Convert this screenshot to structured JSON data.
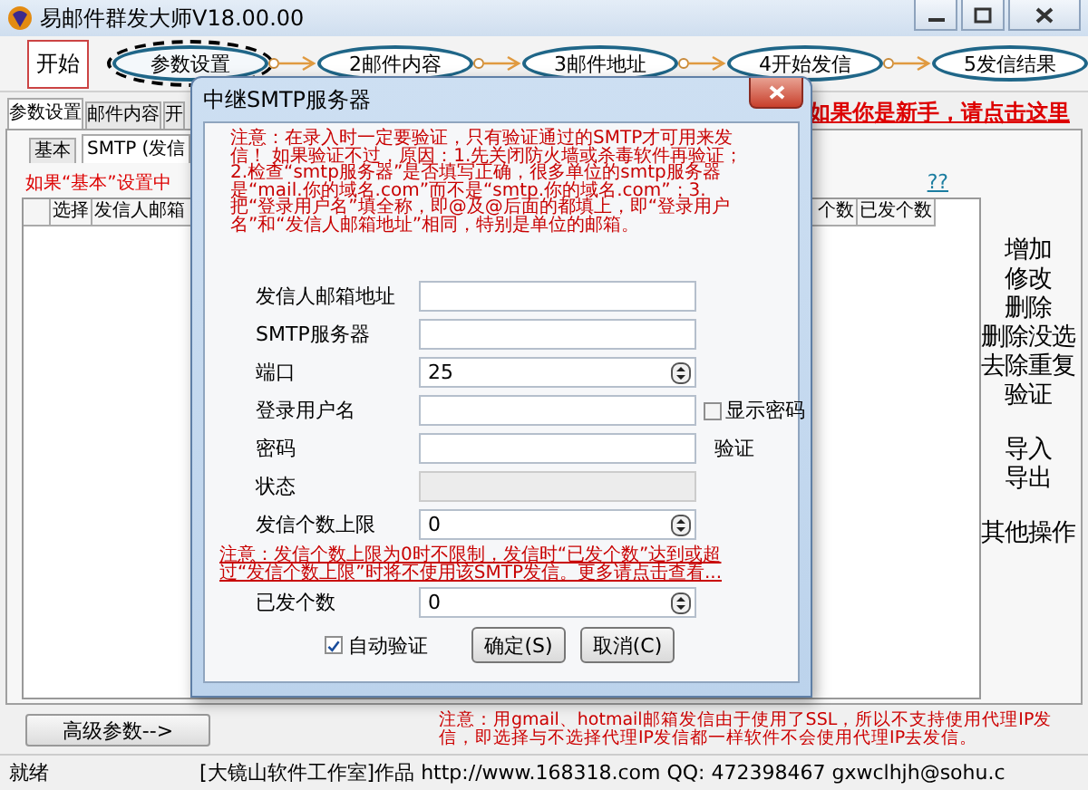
{
  "window": {
    "title": "易邮件群发大师V18.00.00"
  },
  "steps": {
    "start": "开始",
    "items": [
      {
        "label": "参数设置",
        "selected": true
      },
      {
        "label": "2邮件内容",
        "selected": false
      },
      {
        "label": "3邮件地址",
        "selected": false
      },
      {
        "label": "4开始发信",
        "selected": false
      },
      {
        "label": "5发信结果",
        "selected": false
      }
    ]
  },
  "tabs": [
    {
      "label": "参数设置",
      "selected": true
    },
    {
      "label": "邮件内容",
      "selected": false
    },
    {
      "label": "开",
      "selected": false
    }
  ],
  "newbie_link": "如果你是新手，请点击这里",
  "sub_tabs": [
    {
      "label": "基本",
      "selected": false
    },
    {
      "label": "SMTP (发信",
      "selected": true
    }
  ],
  "hint": "如果“基本”设置中",
  "help_link": "??",
  "table": {
    "columns": [
      "选择",
      "发信人邮箱",
      "个数",
      "已发个数"
    ]
  },
  "side_buttons": [
    [
      "增加",
      "修改",
      "删除",
      "删除没选",
      "去除重复",
      "验证"
    ],
    [
      "导入",
      "导出"
    ],
    [
      "其他操作"
    ]
  ],
  "advanced_button": "高级参数-->",
  "ssl_note": "注意：用gmail、hotmail邮箱发信由于使用了SSL，所以不支持使用代理IP发信，即选择与不选择代理IP发信都一样软件不会使用代理IP去发信。",
  "status_bar": {
    "state": "就绪",
    "info": "[大镜山软件工作室]作品 http://www.168318.com QQ: 472398467 gxwclhjh@sohu.c"
  },
  "dialog": {
    "title": "中继SMTP服务器",
    "note": "注意：在录入时一定要验证，只有验证通过的SMTP才可用来发信！ 如果验证不过，原因：1.先关闭防火墙或杀毒软件再验证；2.检查“smtp服务器”是否填写正确，很多单位的smtp服务器是“mail.你的域名.com”而不是“smtp.你的域名.com”；3.把“登录用户名”填全称，即@及@后面的都填上，即“登录用户名”和“发信人邮箱地址”相同，特别是单位的邮箱。",
    "fields": [
      {
        "kind": "text",
        "label": "发信人邮箱地址"
      },
      {
        "kind": "text",
        "label": "SMTP服务器"
      },
      {
        "kind": "spin",
        "label": "端口",
        "value": "25"
      },
      {
        "kind": "text",
        "label": "登录用户名",
        "extra": {
          "kind": "checkbox",
          "label": "显示密码",
          "checked": false
        }
      },
      {
        "kind": "text",
        "label": "密码",
        "extra": {
          "kind": "label",
          "label": "验证"
        }
      },
      {
        "kind": "readonly",
        "label": "状态"
      },
      {
        "kind": "spin",
        "label": "发信个数上限",
        "value": "0"
      },
      {
        "kind": "note",
        "text": "注意：发信个数上限为0时不限制，发信时“已发个数”达到或超过“发信个数上限”时将不使用该SMTP发信。更多请点击查看..."
      },
      {
        "kind": "spin",
        "label": "已发个数",
        "value": "0"
      }
    ],
    "auto_verify": {
      "label": "自动验证",
      "checked": true
    },
    "buttons": [
      "确定(S)",
      "取消(C)"
    ]
  }
}
